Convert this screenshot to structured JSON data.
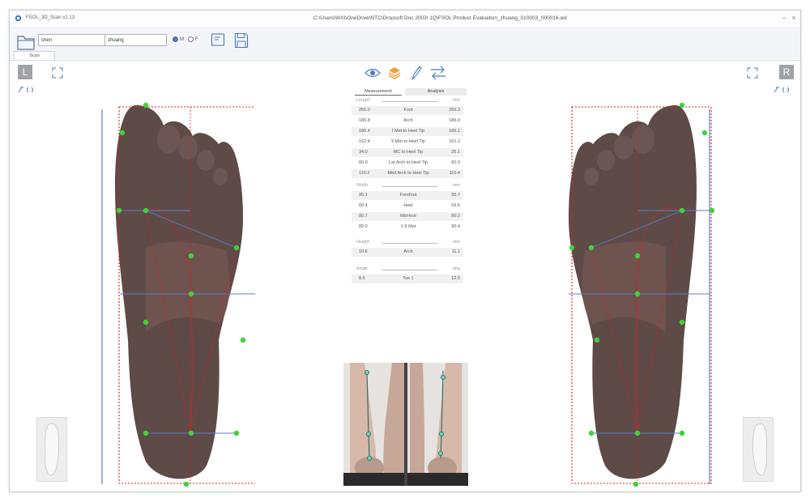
{
  "titlebar": {
    "app_title": "FSOL_3D_Scan v1.13",
    "path": "C:\\Users\\WXI\\OneDrive\\NTC\\Dropsoft Doc 2003\\ 1Q\\FSOL Product Evaluation_zhuang_010003_000016.asl",
    "minimize": "–",
    "close": "×"
  },
  "toolbar": {
    "first_name": "chen",
    "last_name": "zhuang",
    "gender_male": "M",
    "gender_female": "F",
    "gender_selected": "M"
  },
  "tabs": {
    "scan": "Scan"
  },
  "side": {
    "left_label": "L",
    "right_label": "R"
  },
  "panel": {
    "tabs": [
      "Measurement",
      "Analysis"
    ],
    "length": {
      "header": "Length",
      "unit": "mm",
      "rows": [
        {
          "left": "250.0",
          "name": "Foot",
          "right": "250.3"
        },
        {
          "left": "186.8",
          "name": "Arch",
          "right": "186.0"
        },
        {
          "left": "186.4",
          "name": "I Met to Heel Tip",
          "right": "186.1"
        },
        {
          "left": "162.4",
          "name": "5 Met to Heel Tip",
          "right": "161.2"
        },
        {
          "left": "34.0",
          "name": "MC to Heel Tip",
          "right": "35.1"
        },
        {
          "left": "60.0",
          "name": "Lat Arch to Heel Tip",
          "right": "60.3"
        },
        {
          "left": "110.2",
          "name": "Med Arch to Heel Tip",
          "right": "110.4"
        }
      ]
    },
    "width": {
      "header": "Width",
      "unit": "mm",
      "rows": [
        {
          "left": "95.1",
          "name": "Forefoot",
          "right": "95.7"
        },
        {
          "left": "60.4",
          "name": "Heel",
          "right": "59.5"
        },
        {
          "left": "80.7",
          "name": "Mid-foot",
          "right": "80.2"
        },
        {
          "left": "89.0",
          "name": "1-5 Met",
          "right": "90.4"
        }
      ]
    },
    "height": {
      "header": "Height",
      "unit": "mm",
      "rows": [
        {
          "left": "10.6",
          "name": "Arch",
          "right": "11.1"
        }
      ]
    },
    "angle": {
      "header": "Angle",
      "unit": "deg",
      "rows": [
        {
          "left": "8.5",
          "name": "Toe 1",
          "right": "12.5"
        }
      ]
    }
  },
  "colors": {
    "accent": "#4c79c2",
    "marker": "#3fd23a",
    "guide_red": "#e02020",
    "guide_blue": "#5a7ec9",
    "foot_skin": "#5e4a47"
  }
}
